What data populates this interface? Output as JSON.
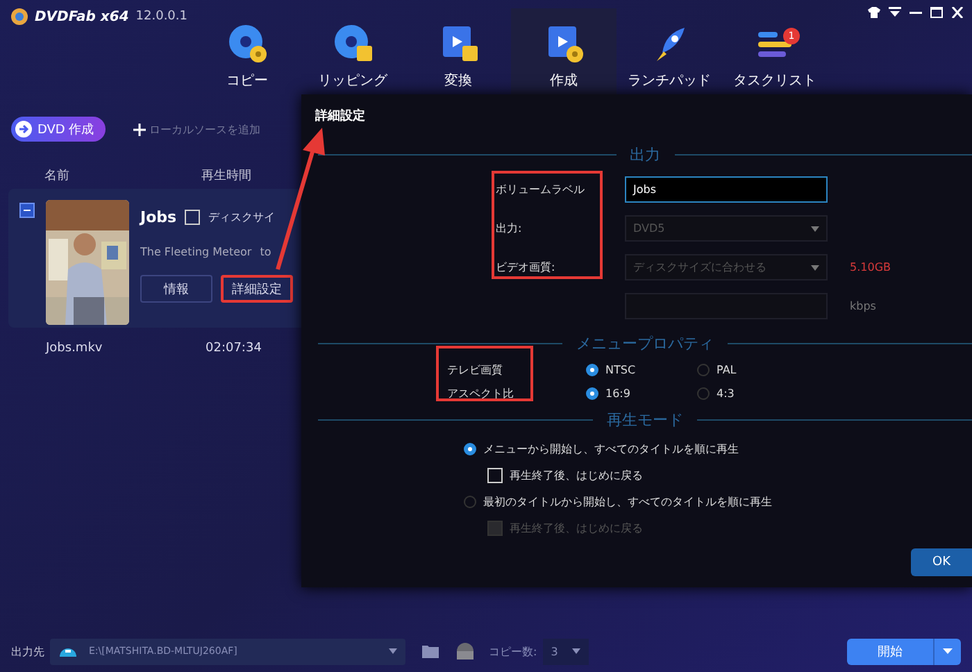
{
  "app": {
    "logo": "DVDFab x64",
    "version": "12.0.0.1"
  },
  "nav": [
    {
      "label": "コピー",
      "selected": false
    },
    {
      "label": "リッピング",
      "selected": false
    },
    {
      "label": "変換",
      "selected": false
    },
    {
      "label": "作成",
      "selected": true
    },
    {
      "label": "ランチパッド",
      "selected": false
    },
    {
      "label": "タスクリスト",
      "selected": false,
      "badge": "1"
    }
  ],
  "toolbar": {
    "mode_button": "DVD 作成",
    "add_source": "ローカルソースを追加"
  },
  "columns": [
    "名前",
    "再生時間"
  ],
  "title": {
    "expanded": true,
    "name": "Jobs",
    "disc_size_checked": false,
    "disc_size_label": "ディスクサイ",
    "audio": "The Fleeting Meteor",
    "subtitle": "to",
    "buttons": [
      {
        "label": "情報",
        "annotated": false
      },
      {
        "label": "詳細設定",
        "annotated": true
      }
    ],
    "file": "Jobs.mkv",
    "duration": "02:07:34"
  },
  "dialog": {
    "title": "詳細設定",
    "output": {
      "heading": "出力",
      "annotated": true,
      "rows": [
        {
          "kind": "input",
          "label": "ボリュームラベル",
          "value": "Jobs"
        },
        {
          "kind": "select",
          "label": "出力:",
          "value": "DVD5"
        },
        {
          "kind": "select",
          "label": "ビデオ画質:",
          "value": "ディスクサイズに合わせる",
          "note": "5.10GB"
        },
        {
          "kind": "input",
          "unit": "kbps"
        }
      ]
    },
    "menu": {
      "heading": "メニュープロパティ",
      "annotated": true,
      "rows": [
        {
          "label": "テレビ画質",
          "options": [
            {
              "label": "NTSC",
              "selected": true
            },
            {
              "label": "PAL",
              "selected": false
            }
          ]
        },
        {
          "label": "アスペクト比",
          "options": [
            {
              "label": "16:9",
              "selected": true
            },
            {
              "label": "4:3",
              "selected": false
            }
          ]
        }
      ]
    },
    "playback": {
      "heading": "再生モード",
      "options": [
        {
          "kind": "radio",
          "label": "メニューから開始し、すべてのタイトルを順に再生",
          "selected": true
        },
        {
          "kind": "checkbox",
          "label": "再生終了後、はじめに戻る",
          "checked": false,
          "disabled": false
        },
        {
          "kind": "radio",
          "label": "最初のタイトルから開始し、すべてのタイトルを順に再生",
          "selected": false
        },
        {
          "kind": "checkbox",
          "label": "再生終了後、はじめに戻る",
          "checked": false,
          "disabled": true
        }
      ]
    },
    "ok": "OK"
  },
  "bottom": {
    "output_label": "出力先",
    "path": "E:\\[MATSHITA.BD-MLTUJ260AF]",
    "copies_label": "コピー数:",
    "copies": "3",
    "start": "開始"
  }
}
